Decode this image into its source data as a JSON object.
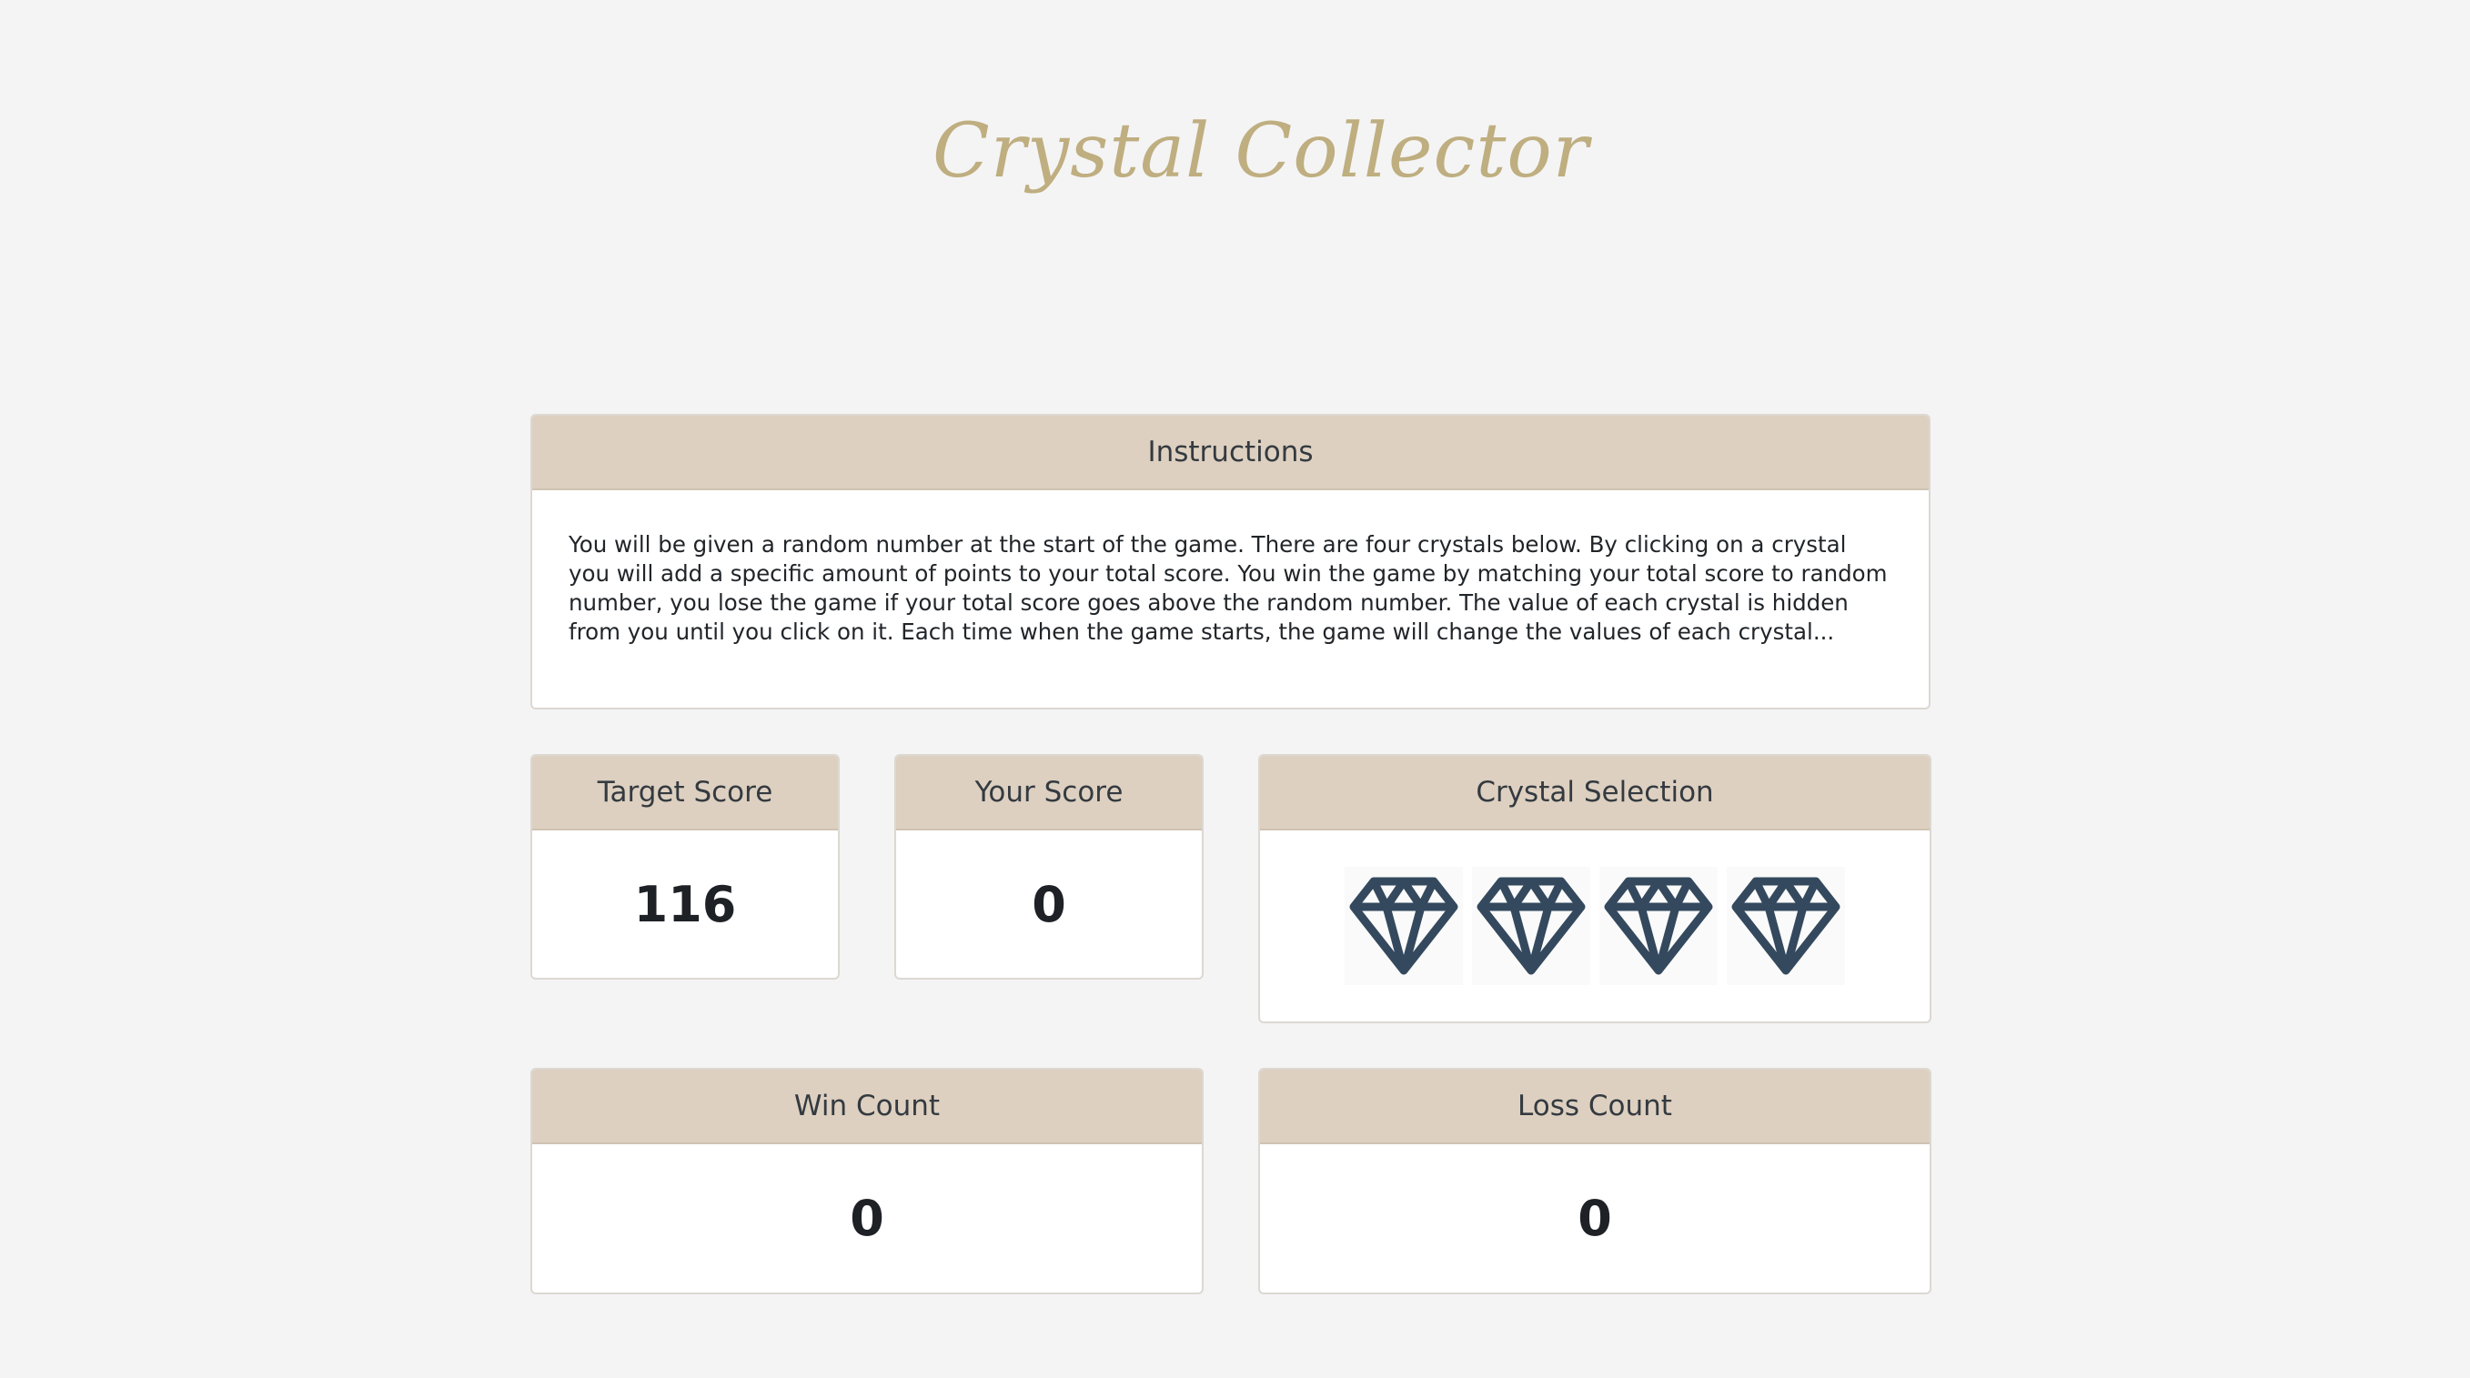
{
  "title": "Crystal Collector",
  "instructions": {
    "header": "Instructions",
    "text": "You will be given a random number at the start of the game. There are four crystals below. By clicking on a crystal you will add a specific amount of points to your total score. You win the game by matching your total score to random number, you lose the game if your total score goes above the random number. The value of each crystal is hidden from you until you click on it. Each time when the game starts, the game will change the values of each crystal..."
  },
  "target": {
    "header": "Target Score",
    "value": "116"
  },
  "score": {
    "header": "Your Score",
    "value": "0"
  },
  "crystals": {
    "header": "Crystal Selection",
    "items": [
      "diamond-icon",
      "diamond-icon",
      "diamond-icon",
      "diamond-icon"
    ],
    "color": "#34495e"
  },
  "wins": {
    "header": "Win Count",
    "value": "0"
  },
  "losses": {
    "header": "Loss Count",
    "value": "0"
  },
  "colors": {
    "title": "#bfae80",
    "header_bg": "#ddd0c0",
    "page_bg": "#f4f4f4"
  }
}
